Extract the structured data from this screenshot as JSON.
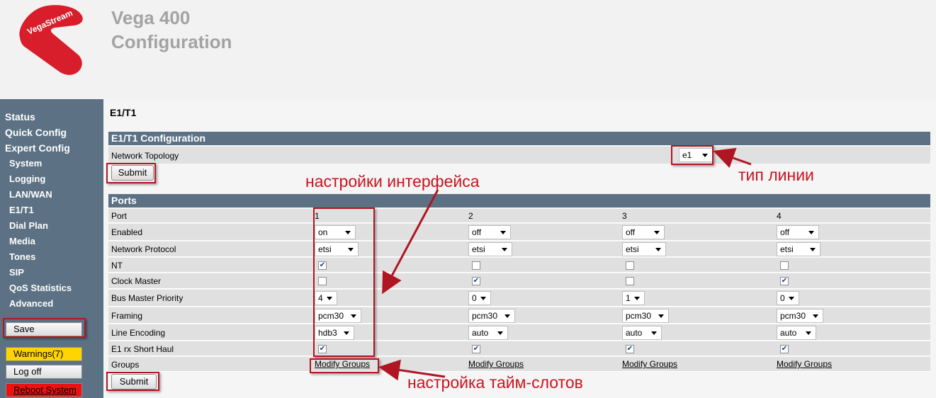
{
  "brand": {
    "logo_text": "VegaStream",
    "logo_color": "#d81e2a"
  },
  "app": {
    "title_line1": "Vega 400",
    "title_line2": "Configuration"
  },
  "sidebar": {
    "items": [
      {
        "label": "Status",
        "sub": false
      },
      {
        "label": "Quick Config",
        "sub": false
      },
      {
        "label": "Expert Config",
        "sub": false
      },
      {
        "label": "System",
        "sub": true
      },
      {
        "label": "Logging",
        "sub": true
      },
      {
        "label": "LAN/WAN",
        "sub": true
      },
      {
        "label": "E1/T1",
        "sub": true
      },
      {
        "label": "Dial Plan",
        "sub": true
      },
      {
        "label": "Media",
        "sub": true
      },
      {
        "label": "Tones",
        "sub": true
      },
      {
        "label": "SIP",
        "sub": true
      },
      {
        "label": "QoS Statistics",
        "sub": true
      },
      {
        "label": "Advanced",
        "sub": true
      }
    ],
    "save_label": "Save",
    "warnings_label": "Warnings(7)",
    "logoff_label": "Log off",
    "reboot_label": "Reboot System"
  },
  "page": {
    "title": "E1/T1"
  },
  "config_section": {
    "heading": "E1/T1 Configuration",
    "topology_label": "Network Topology",
    "topology_value": "e1",
    "submit_label": "Submit"
  },
  "ports_section": {
    "heading": "Ports",
    "row_labels": {
      "port": "Port",
      "enabled": "Enabled",
      "protocol": "Network Protocol",
      "nt": "NT",
      "clock_master": "Clock Master",
      "bus_priority": "Bus Master Priority",
      "framing": "Framing",
      "line_encoding": "Line Encoding",
      "short_haul": "E1 rx Short Haul",
      "groups": "Groups"
    },
    "ports": [
      {
        "number": "1",
        "enabled": "on",
        "protocol": "etsi",
        "nt": true,
        "clock_master": false,
        "bus_priority": "4",
        "framing": "pcm30",
        "line_encoding": "hdb3",
        "short_haul": true,
        "groups_link": "Modify Groups"
      },
      {
        "number": "2",
        "enabled": "off",
        "protocol": "etsi",
        "nt": false,
        "clock_master": true,
        "bus_priority": "0",
        "framing": "pcm30",
        "line_encoding": "auto",
        "short_haul": true,
        "groups_link": "Modify Groups"
      },
      {
        "number": "3",
        "enabled": "off",
        "protocol": "etsi",
        "nt": false,
        "clock_master": false,
        "bus_priority": "1",
        "framing": "pcm30",
        "line_encoding": "auto",
        "short_haul": true,
        "groups_link": "Modify Groups"
      },
      {
        "number": "4",
        "enabled": "off",
        "protocol": "etsi",
        "nt": false,
        "clock_master": true,
        "bus_priority": "0",
        "framing": "pcm30",
        "line_encoding": "auto",
        "short_haul": true,
        "groups_link": "Modify Groups"
      }
    ],
    "submit_label": "Submit"
  },
  "annotations": {
    "line_type": "тип линии",
    "interface_settings": "настройки интерфейса",
    "timeslot_settings": "настройка тайм-слотов",
    "color": "#c8141e"
  }
}
